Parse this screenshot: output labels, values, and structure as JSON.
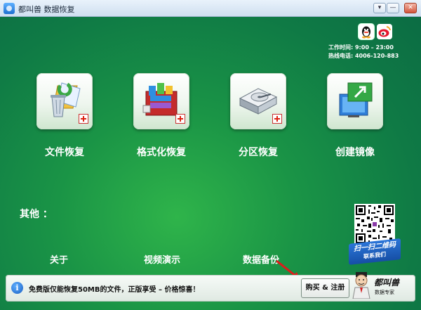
{
  "window": {
    "title": "都叫兽 数据恢复",
    "controls": {
      "menu": "▾",
      "minimize": "—",
      "maximize": "□",
      "close": "✕"
    }
  },
  "contact": {
    "icons": [
      "qq-icon",
      "weibo-icon"
    ],
    "work_hours": "工作时间: 9:00 – 23:00",
    "hotline": "热线电话: 4006-120-883"
  },
  "tiles": [
    {
      "label": "文件恢复",
      "icon": "file-recovery-icon"
    },
    {
      "label": "格式化恢复",
      "icon": "format-recovery-icon"
    },
    {
      "label": "分区恢复",
      "icon": "partition-recovery-icon"
    },
    {
      "label": "创建镜像",
      "icon": "create-image-icon"
    }
  ],
  "others": {
    "title": "其他 ：",
    "links": [
      "关于",
      "视频演示",
      "数据备份"
    ]
  },
  "qr": {
    "line1": "扫一扫二维码",
    "line2": "联系我们"
  },
  "bottom": {
    "info_text": "免费版仅能恢复50MB的文件，正版享受 – 价格惊喜！",
    "buy_label": "购买 & 注册",
    "brand_name": "都叫兽",
    "brand_slogan": "数据专家"
  },
  "colors": {
    "background": "#1a9446",
    "titlebar": "#dfe9f5",
    "accent_red": "#d21f1f",
    "qr_banner": "#1f62c0"
  }
}
